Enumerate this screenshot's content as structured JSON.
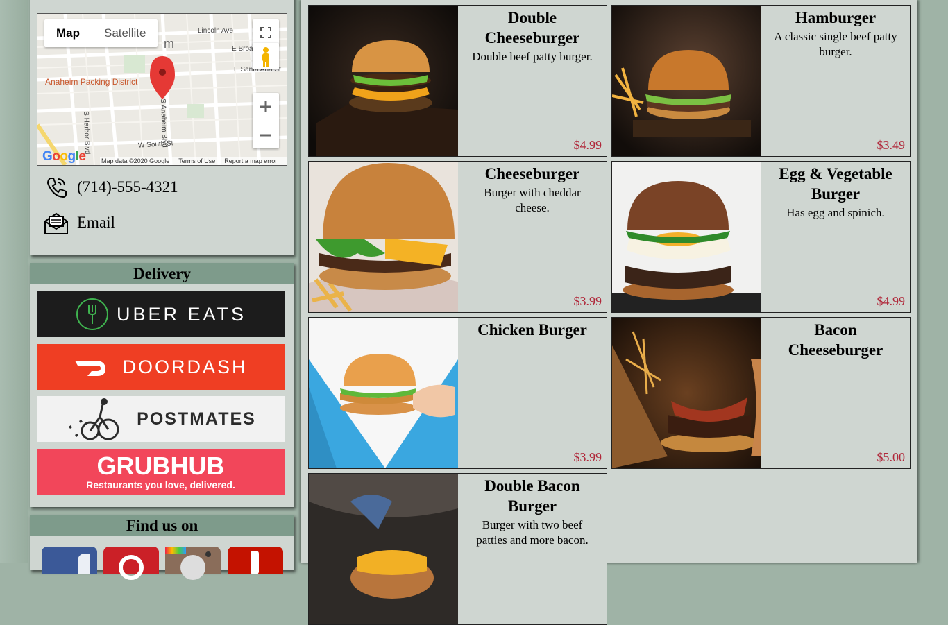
{
  "map": {
    "toggle_map": "Map",
    "toggle_satellite": "Satellite",
    "place_label": "Anaheim Packing District",
    "streets": [
      "Lincoln Ave",
      "E Broadway",
      "E Santa Ana St",
      "S Harbor Blvd",
      "S Anaheim Blvd",
      "W South St"
    ],
    "place_fragment": "m",
    "google": "Google",
    "footer_data": "Map data ©2020 Google",
    "footer_terms": "Terms of Use",
    "footer_report": "Report a map error"
  },
  "contact": {
    "phone": "(714)-555-4321",
    "email": "Email"
  },
  "delivery": {
    "title": "Delivery",
    "services": [
      {
        "name": "UBER EATS",
        "bg": "#1c1c1c",
        "fg": "#ffffff",
        "accent": "#3fb34f"
      },
      {
        "name": "DOORDASH",
        "bg": "#ef3e23",
        "fg": "#ffffff"
      },
      {
        "name": "POSTMATES",
        "bg": "#f2f2f2",
        "fg": "#2b2b2b"
      },
      {
        "name": "GRUBHUB",
        "tagline": "Restaurants you love, delivered.",
        "bg": "#f2465a",
        "fg": "#ffffff"
      }
    ]
  },
  "findus": {
    "title": "Find us on",
    "icons": [
      "facebook-icon",
      "pinterest-icon",
      "instagram-icon",
      "yelp-icon"
    ]
  },
  "menu": [
    {
      "name": "Double Cheeseburger",
      "desc": "Double beef patty burger.",
      "price": "$4.99"
    },
    {
      "name": "Hamburger",
      "desc": "A classic single beef patty burger.",
      "price": "$3.49"
    },
    {
      "name": "Cheeseburger",
      "desc": "Burger with cheddar cheese.",
      "price": "$3.99"
    },
    {
      "name": "Egg & Vegetable Burger",
      "desc": "Has egg and spinich.",
      "price": "$4.99"
    },
    {
      "name": "Chicken Burger",
      "desc": "",
      "price": "$3.99"
    },
    {
      "name": "Bacon Cheeseburger",
      "desc": "",
      "price": "$5.00"
    },
    {
      "name": "Double Bacon Burger",
      "desc": "Burger with two beef patties and more bacon.",
      "price": ""
    }
  ],
  "colors": {
    "page_bg": "#9fb3a6",
    "panel_bg": "#cfd6d1",
    "header_bg": "#7e9b8b",
    "price": "#b0283a"
  }
}
